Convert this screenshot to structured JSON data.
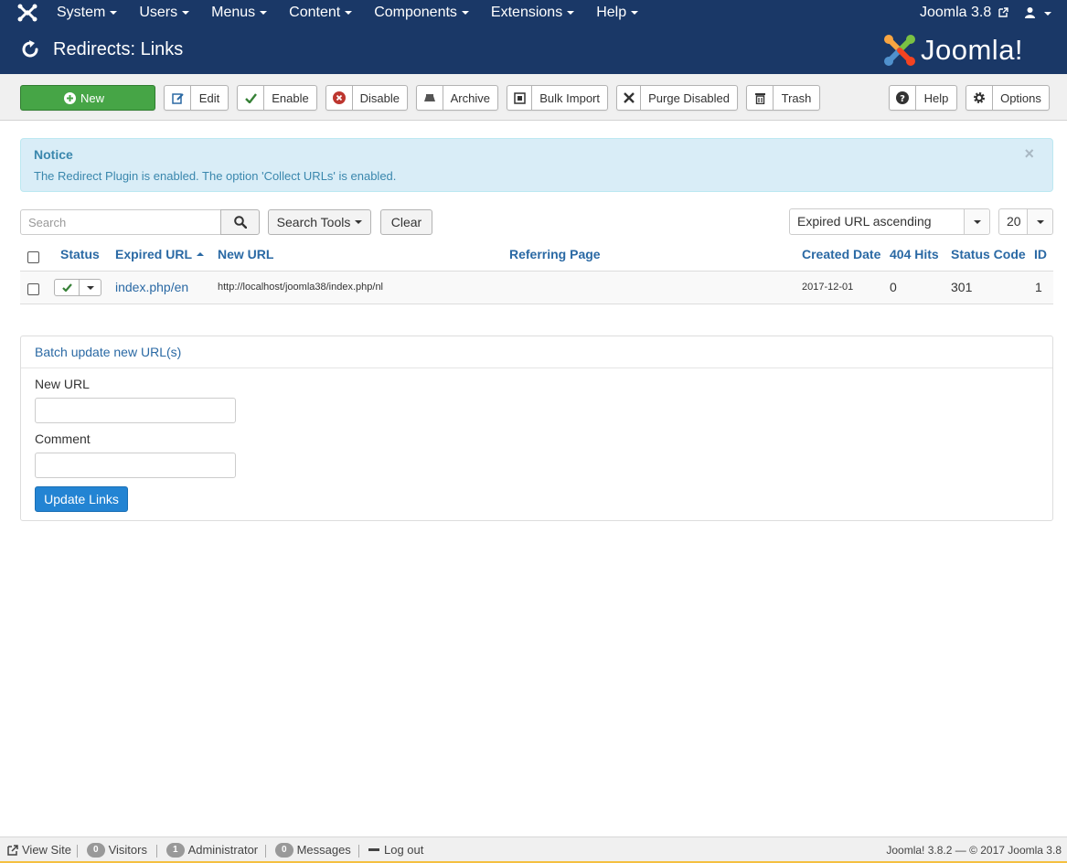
{
  "navbar": {
    "menu": [
      {
        "label": "System"
      },
      {
        "label": "Users"
      },
      {
        "label": "Menus"
      },
      {
        "label": "Content"
      },
      {
        "label": "Components"
      },
      {
        "label": "Extensions"
      },
      {
        "label": "Help"
      }
    ],
    "site_name": "Joomla 3.8"
  },
  "header": {
    "title": "Redirects: Links",
    "brand": "Joomla!"
  },
  "toolbar": {
    "new": "New",
    "edit": "Edit",
    "enable": "Enable",
    "disable": "Disable",
    "archive": "Archive",
    "bulk_import": "Bulk Import",
    "purge_disabled": "Purge Disabled",
    "trash": "Trash",
    "help": "Help",
    "options": "Options"
  },
  "notice": {
    "title": "Notice",
    "message": "The Redirect Plugin is enabled. The option 'Collect URLs' is enabled.",
    "close": "×"
  },
  "filters": {
    "search_placeholder": "Search",
    "search_tools": "Search Tools",
    "clear": "Clear",
    "ordering": "Expired URL ascending",
    "limit": "20"
  },
  "table": {
    "columns": {
      "status": "Status",
      "expired_url": "Expired URL",
      "new_url": "New URL",
      "referring_page": "Referring Page",
      "created_date": "Created Date",
      "hits": "404 Hits",
      "status_code": "Status Code",
      "id": "ID"
    },
    "rows": [
      {
        "expired_url": "index.php/en",
        "new_url": "http://localhost/joomla38/index.php/nl",
        "referring_page": "",
        "created_date": "2017-12-01",
        "hits": "0",
        "status_code": "301",
        "id": "1"
      }
    ]
  },
  "batch": {
    "title": "Batch update new URL(s)",
    "new_url_label": "New URL",
    "new_url_value": "",
    "comment_label": "Comment",
    "comment_value": "",
    "submit": "Update Links"
  },
  "statusbar": {
    "view_site": "View Site",
    "visitors_count": "0",
    "visitors_label": "Visitors",
    "admins_count": "1",
    "admins_label": "Administrator",
    "messages_count": "0",
    "messages_label": "Messages",
    "logout": "Log out",
    "version": "Joomla! 3.8.2  —  © 2017 Joomla 3.8"
  },
  "colors": {
    "navbar": "#1a3867",
    "new_button": "#46a546",
    "link": "#2a69a4",
    "primary_button": "#2384d3",
    "notice_bg": "#d9edf7",
    "footer_accent": "#f5c040"
  }
}
